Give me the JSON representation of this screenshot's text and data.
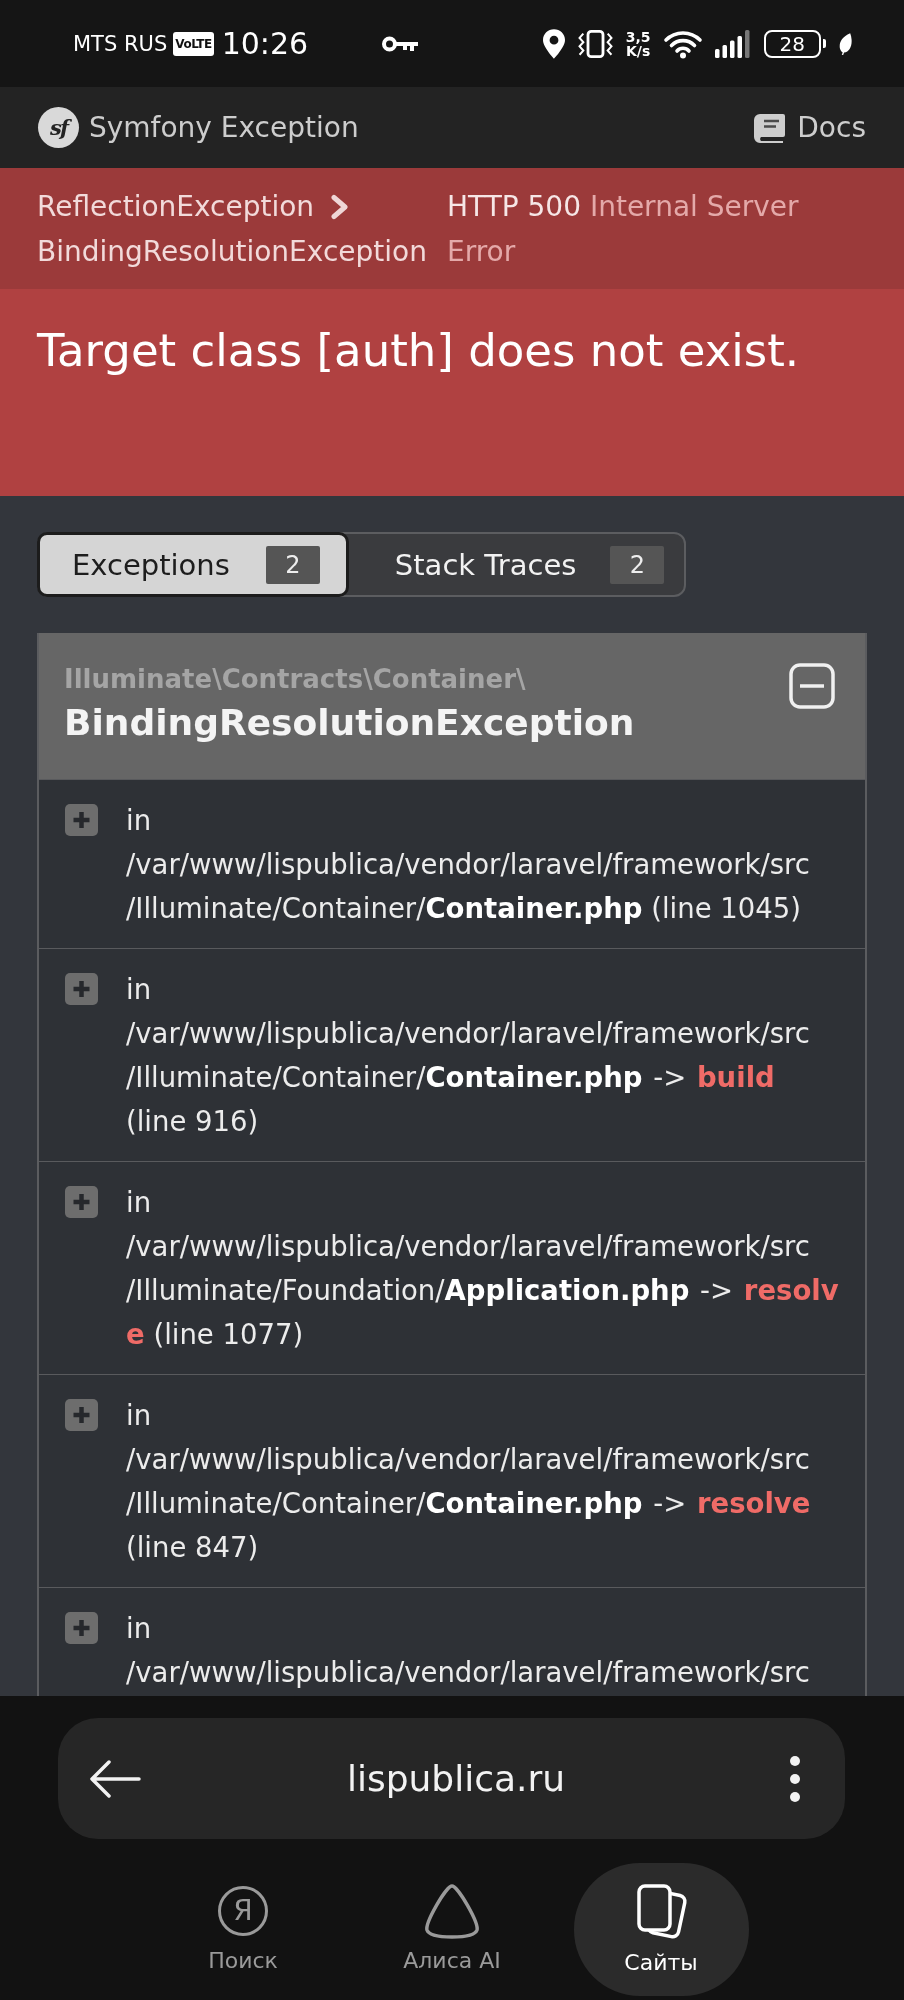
{
  "status_bar": {
    "carrier": "MTS RUS",
    "volte": "VoLTE",
    "time": "10:26",
    "speed_value": "3,5",
    "speed_unit": "K/s",
    "battery": "28"
  },
  "app_header": {
    "logo_text": "sf",
    "title": "Symfony Exception",
    "docs_link": "Docs"
  },
  "breadcrumb": {
    "items": [
      "ReflectionException",
      "BindingResolutionException"
    ],
    "http_status": "HTTP 500",
    "http_text": "Internal Server Error"
  },
  "message": "Target class [auth] does not exist.",
  "tabs": [
    {
      "label": "Exceptions",
      "count": "2",
      "selected": true
    },
    {
      "label": "Stack Traces",
      "count": "2",
      "selected": false
    }
  ],
  "exception": {
    "namespace": "Illuminate\\Contracts\\Container\\",
    "class": "BindingResolutionException",
    "expanded": true,
    "traces": [
      {
        "prefix": "in",
        "path": "/var/www/lispublica/vendor/laravel/framework/src/Illuminate/Container/",
        "file": "Container.php",
        "line": "(line 1045)",
        "expanded": false
      },
      {
        "prefix": "in",
        "path": "/var/www/lispublica/vendor/laravel/framework/src/Illuminate/Container/",
        "file": "Container.php",
        "arrow": "->",
        "function": "build",
        "line": "(line 916)",
        "expanded": false
      },
      {
        "prefix": "in",
        "path": "/var/www/lispublica/vendor/laravel/framework/src/Illuminate/Foundation/",
        "file": "Application.php",
        "arrow": "->",
        "function": "resolve",
        "line": "(line 1077)",
        "expanded": false
      },
      {
        "prefix": "in",
        "path": "/var/www/lispublica/vendor/laravel/framework/src/Illuminate/Container/",
        "file": "Container.php",
        "arrow": "->",
        "function": "resolve",
        "line": "(line 847)",
        "expanded": false
      },
      {
        "prefix": "in",
        "path": "/var/www/lispublica/vendor/laravel/framework/src",
        "expanded": false
      }
    ]
  },
  "browser": {
    "url": "lispublica.ru"
  },
  "bottom_nav": [
    {
      "kind": "search",
      "glyph": "Я",
      "label": "Поиск",
      "selected": false
    },
    {
      "kind": "assistant",
      "label": "Алиса AI",
      "selected": false
    },
    {
      "kind": "sites",
      "label": "Сайты",
      "selected": true
    }
  ]
}
